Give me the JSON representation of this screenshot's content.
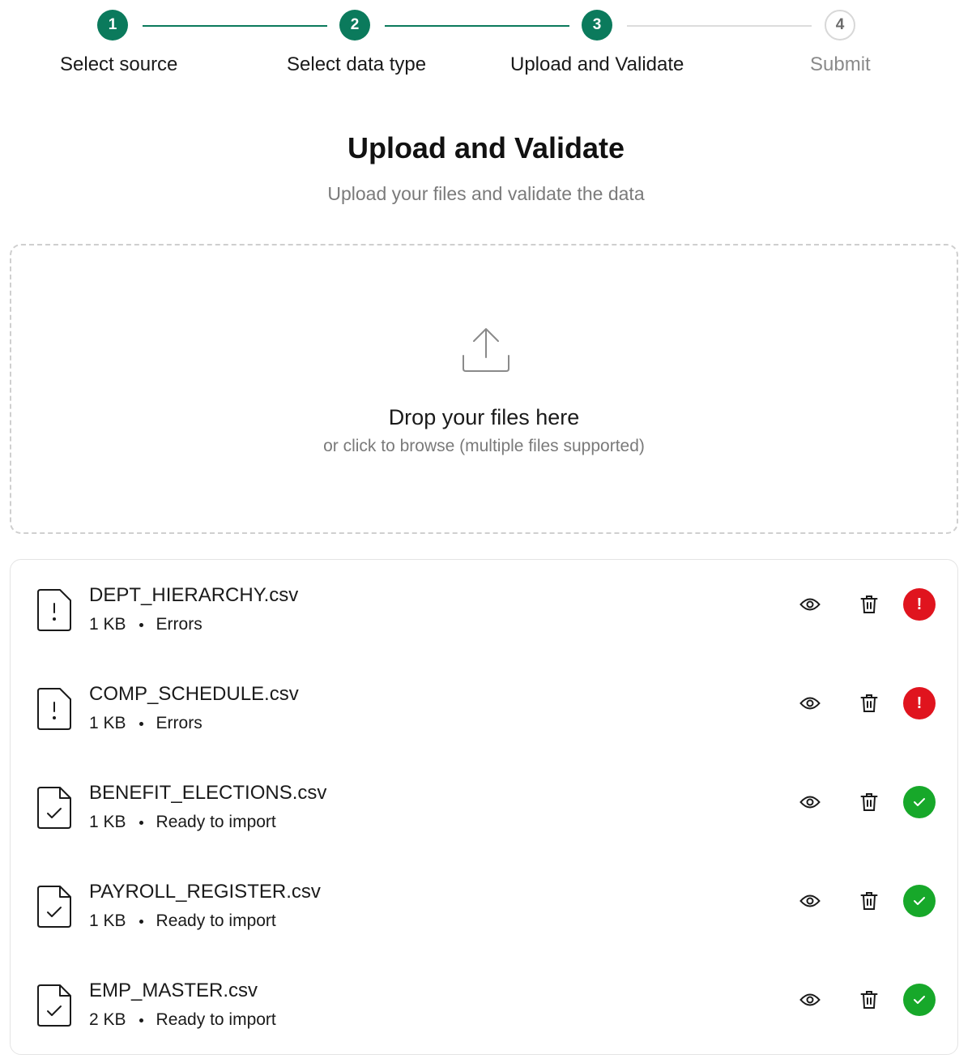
{
  "stepper": {
    "steps": [
      {
        "number": "1",
        "label": "Select source",
        "state": "complete"
      },
      {
        "number": "2",
        "label": "Select data type",
        "state": "complete"
      },
      {
        "number": "3",
        "label": "Upload and Validate",
        "state": "current"
      },
      {
        "number": "4",
        "label": "Submit",
        "state": "upcoming"
      }
    ]
  },
  "header": {
    "title": "Upload and Validate",
    "subtitle": "Upload your files and validate the data"
  },
  "dropzone": {
    "title": "Drop your files here",
    "hint": "or click to browse (multiple files supported)",
    "icon": "upload-icon"
  },
  "files": [
    {
      "name": "DEPT_HIERARCHY.csv",
      "size": "1 KB",
      "status": "Errors",
      "status_type": "error"
    },
    {
      "name": "COMP_SCHEDULE.csv",
      "size": "1 KB",
      "status": "Errors",
      "status_type": "error"
    },
    {
      "name": "BENEFIT_ELECTIONS.csv",
      "size": "1 KB",
      "status": "Ready to import",
      "status_type": "ok"
    },
    {
      "name": "PAYROLL_REGISTER.csv",
      "size": "1 KB",
      "status": "Ready to import",
      "status_type": "ok"
    },
    {
      "name": "EMP_MASTER.csv",
      "size": "2 KB",
      "status": "Ready to import",
      "status_type": "ok"
    }
  ],
  "colors": {
    "accent": "#0b7a5c",
    "error": "#e0141e",
    "success": "#17a82a"
  }
}
